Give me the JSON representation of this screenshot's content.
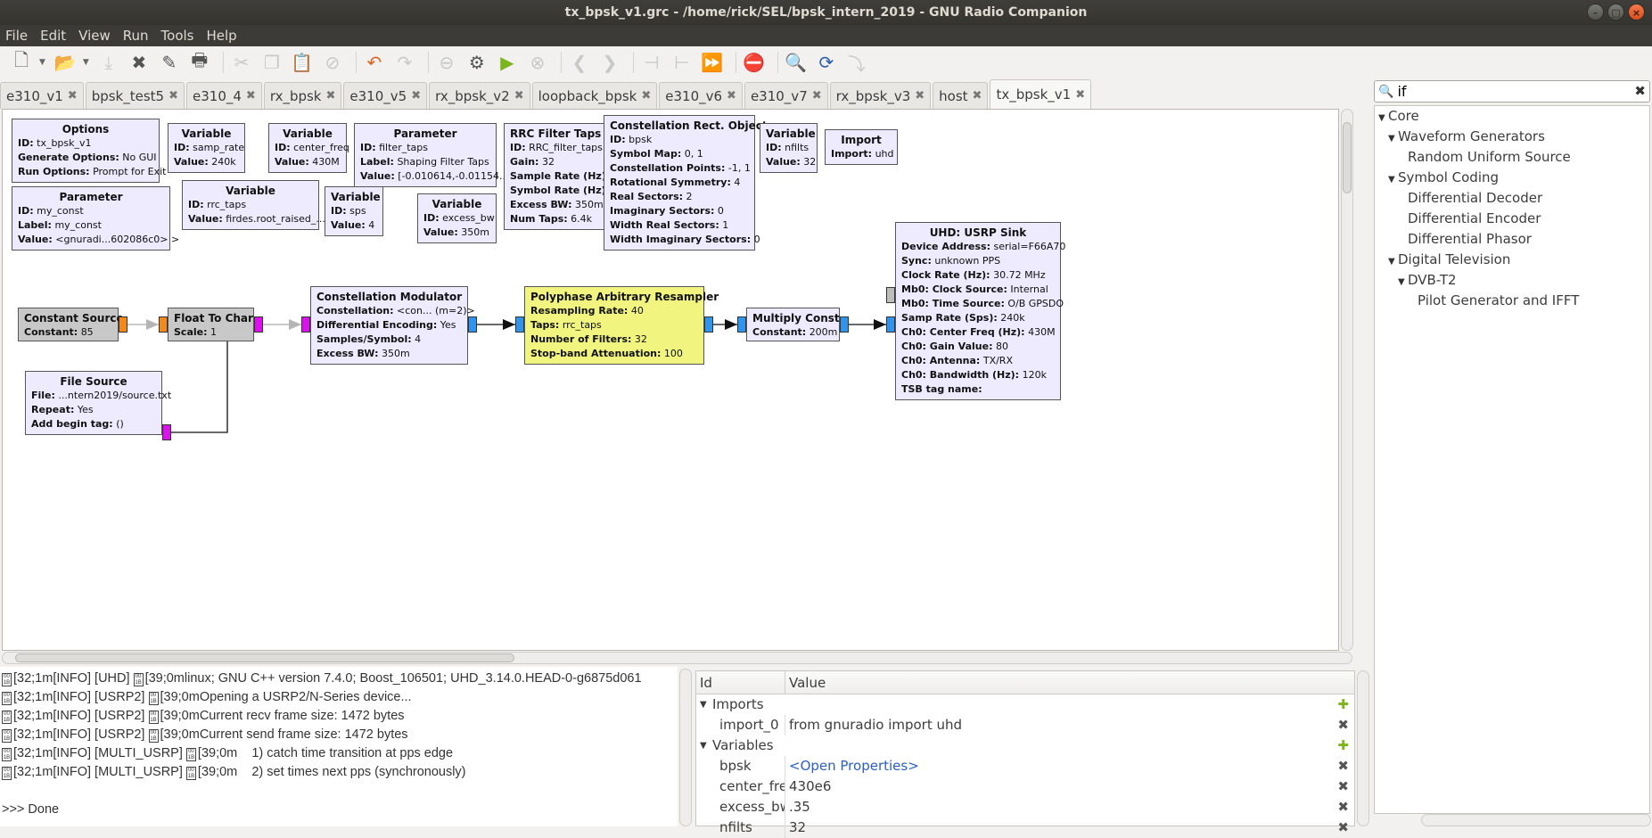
{
  "window": {
    "title": "tx_bpsk_v1.grc - /home/rick/SEL/bpsk_intern_2019 - GNU Radio Companion",
    "controls": {
      "minimize": "–",
      "maximize": "□",
      "close": "×"
    }
  },
  "menu": [
    "File",
    "Edit",
    "View",
    "Run",
    "Tools",
    "Help"
  ],
  "toolbar": [
    {
      "name": "new-icon",
      "glyph": "🗋",
      "enabled": true
    },
    {
      "name": "open-icon",
      "glyph": "📂",
      "enabled": true
    },
    {
      "name": "save-icon",
      "glyph": "⤓",
      "enabled": false
    },
    {
      "name": "close-icon",
      "glyph": "✖",
      "enabled": true
    },
    {
      "name": "edit-icon",
      "glyph": "✎",
      "enabled": true
    },
    {
      "name": "print-icon",
      "glyph": "🖶",
      "enabled": true
    },
    {
      "name": "cut-icon",
      "glyph": "✂",
      "enabled": false
    },
    {
      "name": "copy-icon",
      "glyph": "❐",
      "enabled": false
    },
    {
      "name": "paste-icon",
      "glyph": "📋",
      "enabled": false
    },
    {
      "name": "delete-icon",
      "glyph": "⊘",
      "enabled": false
    },
    {
      "name": "undo-icon",
      "glyph": "↶",
      "enabled": true
    },
    {
      "name": "redo-icon",
      "glyph": "↷",
      "enabled": false
    },
    {
      "name": "disable-icon",
      "glyph": "⊖",
      "enabled": false
    },
    {
      "name": "generate-icon",
      "glyph": "⚙",
      "enabled": true
    },
    {
      "name": "execute-icon",
      "glyph": "▶",
      "enabled": true
    },
    {
      "name": "kill-icon",
      "glyph": "⊗",
      "enabled": false
    },
    {
      "name": "rotate-left-icon",
      "glyph": "❮",
      "enabled": false
    },
    {
      "name": "rotate-right-icon",
      "glyph": "❯",
      "enabled": false
    },
    {
      "name": "enable-icon",
      "glyph": "⊣",
      "enabled": false
    },
    {
      "name": "bypass-icon",
      "glyph": "⊢",
      "enabled": false
    },
    {
      "name": "bypass-flow-icon",
      "glyph": "⏩",
      "enabled": false
    },
    {
      "name": "errors-icon",
      "glyph": "⛔",
      "enabled": true
    },
    {
      "name": "find-icon",
      "glyph": "🔍",
      "enabled": true
    },
    {
      "name": "reload-icon",
      "glyph": "⟳",
      "enabled": true
    },
    {
      "name": "reload-all-icon",
      "glyph": "⤵",
      "enabled": false
    }
  ],
  "tabs": [
    {
      "label": "e310_v1"
    },
    {
      "label": "bpsk_test5"
    },
    {
      "label": "e310_4"
    },
    {
      "label": "rx_bpsk"
    },
    {
      "label": "e310_v5"
    },
    {
      "label": "rx_bpsk_v2"
    },
    {
      "label": "loopback_bpsk"
    },
    {
      "label": "e310_v6"
    },
    {
      "label": "e310_v7"
    },
    {
      "label": "rx_bpsk_v3"
    },
    {
      "label": "host"
    },
    {
      "label": "tx_bpsk_v1",
      "active": true
    }
  ],
  "blocks": {
    "options": {
      "title": "Options",
      "rows": [
        [
          "ID:",
          "tx_bpsk_v1"
        ],
        [
          "Generate Options:",
          "No GUI"
        ],
        [
          "Run Options:",
          "Prompt for Exit"
        ]
      ]
    },
    "samp_rate": {
      "title": "Variable",
      "rows": [
        [
          "ID:",
          "samp_rate"
        ],
        [
          "Value:",
          "240k"
        ]
      ]
    },
    "center_freq": {
      "title": "Variable",
      "rows": [
        [
          "ID:",
          "center_freq"
        ],
        [
          "Value:",
          "430M"
        ]
      ]
    },
    "filter_taps": {
      "title": "Parameter",
      "rows": [
        [
          "ID:",
          "filter_taps"
        ],
        [
          "Label:",
          "Shaping Filter Taps"
        ],
        [
          "Value:",
          "[-0.010614,-0.01154..."
        ]
      ]
    },
    "rrc": {
      "title": "RRC Filter Taps",
      "rows": [
        [
          "ID:",
          "RRC_filter_taps"
        ],
        [
          "Gain:",
          "32"
        ],
        [
          "Sample Rate (Hz):",
          ""
        ],
        [
          "Symbol Rate (Hz):",
          ""
        ],
        [
          "Excess BW:",
          "350m"
        ],
        [
          "Num Taps:",
          "6.4k"
        ]
      ]
    },
    "bpsk": {
      "title": "Constellation Rect. Object",
      "rows": [
        [
          "ID:",
          "bpsk"
        ],
        [
          "Symbol Map:",
          "0, 1"
        ],
        [
          "Constellation Points:",
          "-1, 1"
        ],
        [
          "Rotational Symmetry:",
          "4"
        ],
        [
          "Real Sectors:",
          "2"
        ],
        [
          "Imaginary Sectors:",
          "0"
        ],
        [
          "Width Real Sectors:",
          "1"
        ],
        [
          "Width Imaginary Sectors:",
          "0"
        ]
      ]
    },
    "nfilts": {
      "title": "Variable",
      "rows": [
        [
          "ID:",
          "nfilts"
        ],
        [
          "Value:",
          "32"
        ]
      ]
    },
    "import": {
      "title": "Import",
      "rows": [
        [
          "Import:",
          "uhd"
        ]
      ]
    },
    "my_const": {
      "title": "Parameter",
      "rows": [
        [
          "ID:",
          "my_const"
        ],
        [
          "Label:",
          "my_const"
        ],
        [
          "Value:",
          "<gnuradi...602086c0> >"
        ]
      ]
    },
    "rrc_taps": {
      "title": "Variable",
      "rows": [
        [
          "ID:",
          "rrc_taps"
        ],
        [
          "Value:",
          "firdes.root_raised_..."
        ]
      ]
    },
    "sps": {
      "title": "Variable",
      "rows": [
        [
          "ID:",
          "sps"
        ],
        [
          "Value:",
          "4"
        ]
      ]
    },
    "excess_bw": {
      "title": "Variable",
      "rows": [
        [
          "ID:",
          "excess_bw"
        ],
        [
          "Value:",
          "350m"
        ]
      ]
    },
    "const_src": {
      "title": "Constant Source",
      "rows": [
        [
          "Constant:",
          "85"
        ]
      ]
    },
    "f2c": {
      "title": "Float To Char",
      "rows": [
        [
          "Scale:",
          "1"
        ]
      ]
    },
    "mod": {
      "title": "Constellation Modulator",
      "rows": [
        [
          "Constellation:",
          "<con... (m=2)>"
        ],
        [
          "Differential Encoding:",
          "Yes"
        ],
        [
          "Samples/Symbol:",
          "4"
        ],
        [
          "Excess BW:",
          "350m"
        ]
      ]
    },
    "file_src": {
      "title": "File Source",
      "rows": [
        [
          "File:",
          "...ntern2019/source.txt"
        ],
        [
          "Repeat:",
          "Yes"
        ],
        [
          "Add begin tag:",
          "()"
        ]
      ]
    },
    "resamp": {
      "title": "Polyphase Arbitrary Resampler",
      "rows": [
        [
          "Resampling Rate:",
          "40"
        ],
        [
          "Taps:",
          "rrc_taps"
        ],
        [
          "Number of Filters:",
          "32"
        ],
        [
          "Stop-band Attenuation:",
          "100"
        ]
      ]
    },
    "mult": {
      "title": "Multiply Const",
      "rows": [
        [
          "Constant:",
          "200m"
        ]
      ]
    },
    "usrp": {
      "title": "UHD: USRP Sink",
      "rows": [
        [
          "Device Address:",
          "serial=F66A70"
        ],
        [
          "Sync:",
          "unknown PPS"
        ],
        [
          "Clock Rate (Hz):",
          "30.72 MHz"
        ],
        [
          "Mb0: Clock Source:",
          "Internal"
        ],
        [
          "Mb0: Time Source:",
          "O/B GPSDO"
        ],
        [
          "Samp Rate (Sps):",
          "240k"
        ],
        [
          "Ch0: Center Freq (Hz):",
          "430M"
        ],
        [
          "Ch0: Gain Value:",
          "80"
        ],
        [
          "Ch0: Antenna:",
          "TX/RX"
        ],
        [
          "Ch0: Bandwidth (Hz):",
          "120k"
        ],
        [
          "TSB tag name:",
          ""
        ]
      ]
    }
  },
  "colors": {
    "block_bg": "#eeeaff",
    "disabled_block_bg": "#c8c8c8",
    "highlight_block_bg": "#f1f57f",
    "port_float": "#f28a1b",
    "port_byte": "#dd11ee",
    "port_complex": "#2e94ee"
  },
  "search": {
    "value": "if",
    "icon": "search-icon"
  },
  "tree": [
    {
      "label": "Core",
      "level": 0,
      "expanded": true
    },
    {
      "label": "Waveform Generators",
      "level": 1,
      "expanded": true
    },
    {
      "label": "Random Uniform Source",
      "level": 2
    },
    {
      "label": "Symbol Coding",
      "level": 1,
      "expanded": true
    },
    {
      "label": "Differential Decoder",
      "level": 2
    },
    {
      "label": "Differential Encoder",
      "level": 2
    },
    {
      "label": "Differential Phasor",
      "level": 2
    },
    {
      "label": "Digital Television",
      "level": 1,
      "expanded": true
    },
    {
      "label": "DVB-T2",
      "level": 2,
      "expanded": true
    },
    {
      "label": "Pilot Generator and IFFT",
      "level": 3
    }
  ],
  "console": [
    {
      "pre": "[32;1m[INFO] [UHD] ",
      "post": "[39;0mlinux; GNU C++ version 7.4.0; Boost_106501; UHD_3.14.0.HEAD-0-g6875d061"
    },
    {
      "pre": "[32;1m[INFO] [USRP2] ",
      "post": "[39;0mOpening a USRP2/N-Series device..."
    },
    {
      "pre": "[32;1m[INFO] [USRP2] ",
      "post": "[39;0mCurrent recv frame size: 1472 bytes"
    },
    {
      "pre": "[32;1m[INFO] [USRP2] ",
      "post": "[39;0mCurrent send frame size: 1472 bytes"
    },
    {
      "pre": "[32;1m[INFO] [MULTI_USRP] ",
      "post": "[39;0m    1) catch time transition at pps edge"
    },
    {
      "pre": "[32;1m[INFO] [MULTI_USRP] ",
      "post": "[39;0m    2) set times next pps (synchronously)"
    },
    {
      "pre": "",
      "post": ""
    },
    {
      "pre": "",
      ">>>": true,
      "post": ">>> Done"
    }
  ],
  "variables_panel": {
    "headers": {
      "id": "Id",
      "value": "Value"
    },
    "rows": [
      {
        "id": "Imports",
        "value": "",
        "group": true,
        "action": "add"
      },
      {
        "id": "import_0",
        "value": "from gnuradio import uhd",
        "action": "remove"
      },
      {
        "id": "Variables",
        "value": "",
        "group": true,
        "action": "add"
      },
      {
        "id": "bpsk",
        "value": "<Open Properties>",
        "link": true,
        "action": "remove"
      },
      {
        "id": "center_freq",
        "value": "430e6",
        "action": "remove"
      },
      {
        "id": "excess_bw",
        "value": ".35",
        "action": "remove"
      },
      {
        "id": "nfilts",
        "value": "32",
        "action": "remove"
      }
    ]
  }
}
